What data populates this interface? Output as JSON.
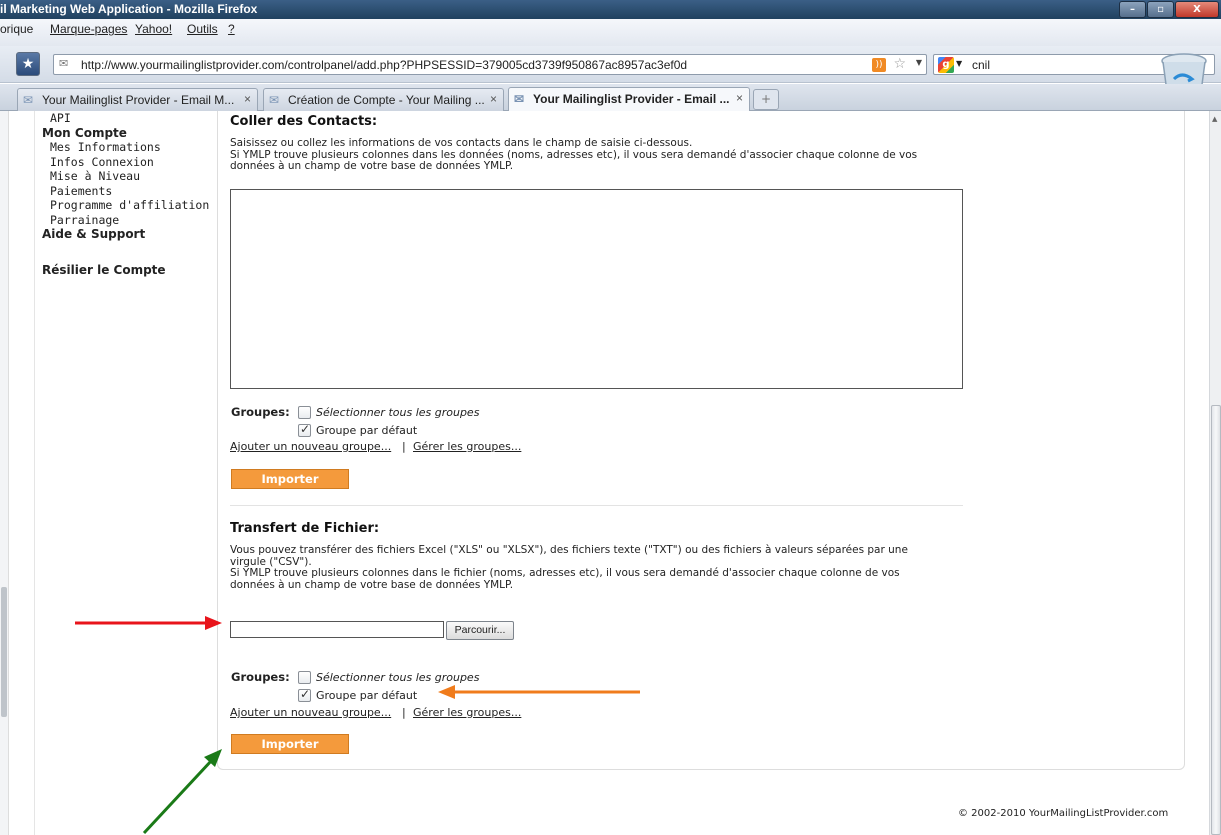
{
  "window": {
    "title": "il Marketing Web Application - Mozilla Firefox",
    "buttons": [
      "–",
      "▫",
      "X"
    ]
  },
  "menubar": {
    "items": [
      "orique",
      "Marque-pages",
      "Yahoo!",
      "Outils",
      "?"
    ]
  },
  "navbar": {
    "url": "http://www.yourmailinglistprovider.com/controlpanel/add.php?PHPSESSID=379005cd3739f950867ac8957ac3ef0d",
    "search_query": "cnil"
  },
  "tabs": [
    {
      "label": "Your Mailinglist Provider - Email M...",
      "active": false
    },
    {
      "label": "Création de Compte - Your Mailing ...",
      "active": false
    },
    {
      "label": "Your Mailinglist Provider - Email ...",
      "active": true
    }
  ],
  "tab_close": "×",
  "new_tab": "+",
  "sidebar": {
    "item_api": "API",
    "head_account": "Mon Compte",
    "account_items": [
      "Mes Informations",
      "Infos Connexion",
      "Mise à Niveau",
      "Paiements",
      "Programme d'affiliation",
      "Parrainage"
    ],
    "head_help": "Aide & Support",
    "head_cancel": "Résilier le Compte"
  },
  "paste_section": {
    "title": "Coller des Contacts:",
    "description": "Saisissez ou collez les informations de vos contacts dans le champ de saisie ci-dessous.\nSi YMLP trouve plusieurs colonnes dans les données (noms, adresses etc), il vous sera demandé d'associer chaque colonne de vos\ndonnées à un champ de votre base de données YMLP.",
    "groups_label": "Groupes:",
    "select_all": "Sélectionner tous les groupes",
    "default_group": "Groupe par défaut",
    "default_checked": true,
    "add_group_link": "Ajouter un nouveau groupe...",
    "separator": "|",
    "manage_groups_link": "Gérer les groupes...",
    "import_button": "Importer"
  },
  "upload_section": {
    "title": "Transfert de Fichier:",
    "description": "Vous pouvez transférer des fichiers Excel (\"XLS\" ou \"XLSX\"), des fichiers texte (\"TXT\") ou des fichiers à valeurs séparées par une\nvirgule (\"CSV\").\nSi YMLP trouve plusieurs colonnes dans le fichier (noms, adresses etc), il vous sera demandé d'associer chaque colonne de vos\ndonnées à un champ de votre base de données YMLP.",
    "browse_button": "Parcourir...",
    "groups_label": "Groupes:",
    "select_all": "Sélectionner tous les groupes",
    "default_group": "Groupe par défaut",
    "default_checked": true,
    "add_group_link": "Ajouter un nouveau groupe...",
    "separator": "|",
    "manage_groups_link": "Gérer les groupes...",
    "import_button": "Importer"
  },
  "footer": "© 2002-2010 YourMailingListProvider.com",
  "colors": {
    "accent_button": "#f49a3c",
    "arrow_red": "#e8141b",
    "arrow_orange": "#f07c1c",
    "arrow_green": "#1a7a17"
  }
}
